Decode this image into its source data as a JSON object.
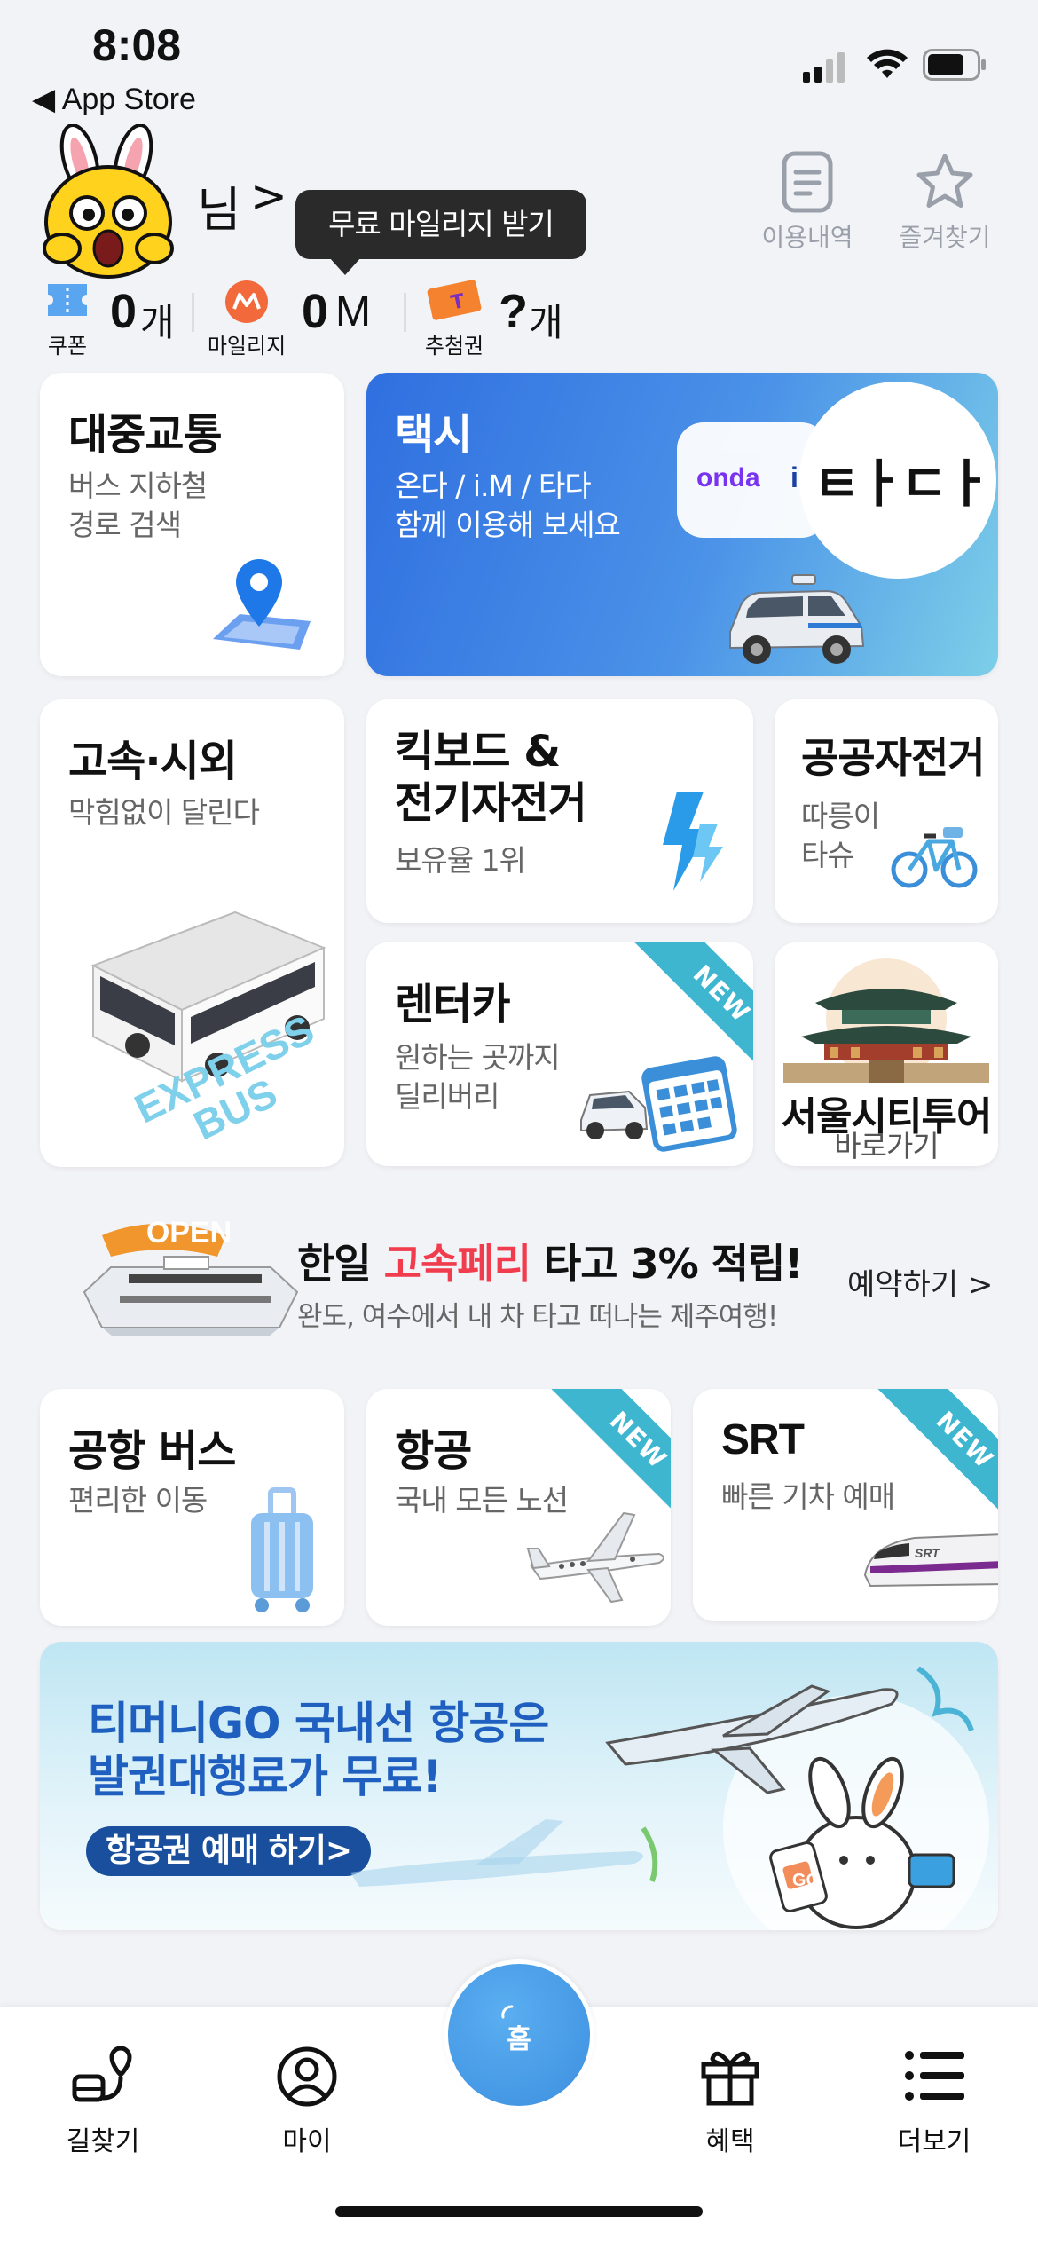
{
  "status_bar": {
    "time": "8:08",
    "back_label": "◀ App Store"
  },
  "header": {
    "greeting_suffix": "님",
    "chevron": ">",
    "tooltip": "무료 마일리지 받기",
    "history_label": "이용내역",
    "favorites_label": "즐겨찾기"
  },
  "stats": {
    "coupon": {
      "value": "0",
      "unit": "개",
      "label": "쿠폰"
    },
    "mileage": {
      "value": "0",
      "unit": "M",
      "label": "마일리지"
    },
    "lottery": {
      "value": "?",
      "unit": "개",
      "label": "추첨권"
    }
  },
  "cards": {
    "transit": {
      "title": "대중교통",
      "subtitle": "버스 지하철\n경로 검색"
    },
    "taxi": {
      "title": "택시",
      "subtitle": "온다 / i.M / 타다\n함께 이용해 보세요",
      "onda": "onda",
      "i": "i",
      "tada": "ㅌㅏㄷㅏ"
    },
    "express": {
      "title": "고속·시외",
      "subtitle": "막힘없이 달린다",
      "bus_text": "EXPRESS BUS"
    },
    "kickboard": {
      "title": "킥보드 &\n전기자전거",
      "subtitle": "보유율 1위"
    },
    "bike": {
      "title": "공공자전거",
      "subtitle": "따릉이\n타슈"
    },
    "rentcar": {
      "title": "렌터카",
      "subtitle": "원하는 곳까지\n딜리버리",
      "badge": "NEW"
    },
    "citytour": {
      "title": "서울시티투어",
      "subtitle": "바로가기"
    }
  },
  "ferry_banner": {
    "open_badge": "OPEN",
    "headline_pre": "한일 ",
    "headline_hl": "고속페리",
    "headline_post": " 타고 3% 적립!",
    "subline": "완도, 여수에서 내 차 타고 떠나는 제주여행!",
    "action": "예약하기 >"
  },
  "cards2": {
    "airport_bus": {
      "title": "공항 버스",
      "subtitle": "편리한 이동"
    },
    "air": {
      "title": "항공",
      "subtitle": "국내 모든 노선",
      "badge": "NEW"
    },
    "srt": {
      "title": "SRT",
      "subtitle": "빠른 기차 예매",
      "badge": "NEW",
      "train_text": "SRT"
    }
  },
  "promo": {
    "line1": "티머니GO 국내선 항공은",
    "line2": "발권대행료가 무료!",
    "button": "항공권 예매 하기>",
    "go_text": "GO"
  },
  "bottom_nav": {
    "route": "길찾기",
    "my": "마이",
    "home": "홈",
    "benefit": "혜택",
    "more": "더보기"
  },
  "colors": {
    "accent_blue": "#2f6fe0",
    "highlight_red": "#f03c4c",
    "ribbon": "#3fb6d0",
    "home_button": "#4a9fe8"
  }
}
